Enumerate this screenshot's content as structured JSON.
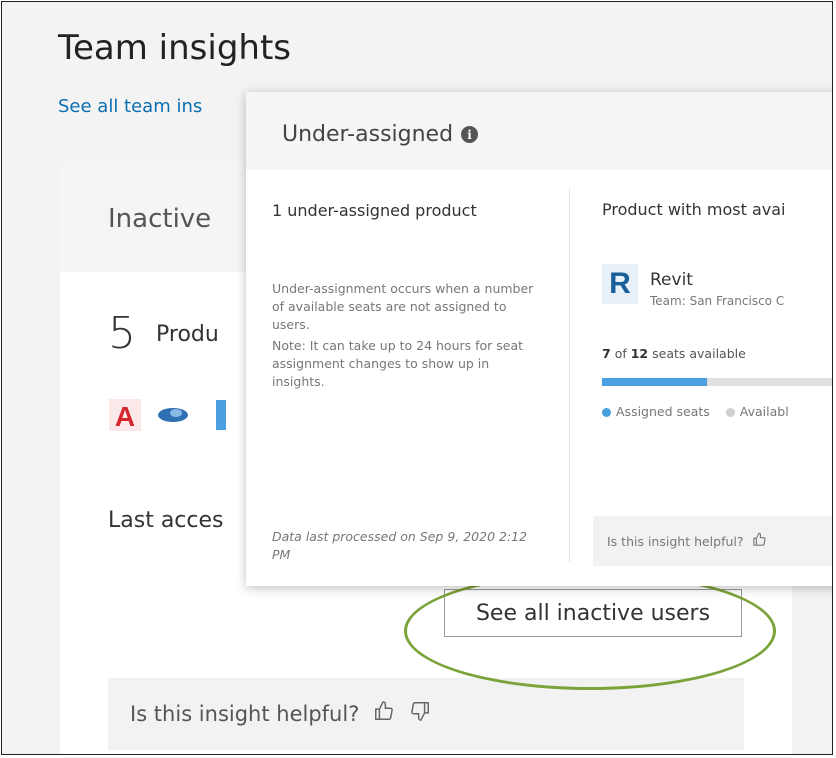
{
  "page": {
    "title": "Team insights",
    "see_all_link": "See all team ins"
  },
  "inactive_card": {
    "title": "Inactive",
    "count": "5",
    "count_label": "Produ",
    "product_icons": [
      "autocad-icon",
      "product-icon-2",
      "product-icon-3"
    ],
    "last_access_label": "Last acces",
    "see_all_button": "See all inactive users",
    "feedback_text": "Is this insight helpful?"
  },
  "popover": {
    "title": "Under-assigned",
    "left": {
      "heading": "1 under-assigned product",
      "description": "Under-assignment occurs when a number of available seats are not assigned to users.",
      "note": "Note: It can take up to 24 hours for seat assignment changes to show up in insights.",
      "processed": "Data last processed on Sep 9, 2020 2:12 PM"
    },
    "right": {
      "heading": "Product with most avai",
      "product_name": "Revit",
      "product_logo_letter": "R",
      "team": "Team: San Francisco C",
      "seats_available": "7",
      "seats_of": "of",
      "seats_total": "12",
      "seats_suffix": "seats available",
      "assigned_fraction": 0.42,
      "legend_assigned": "Assigned seats",
      "legend_available": "Availabl",
      "feedback_text": "Is this insight helpful?"
    }
  },
  "colors": {
    "link": "#0a6fb0",
    "bar_fill": "#4a9fe0",
    "highlight": "#7ca33a",
    "autocad_red": "#d4262c",
    "revit_blue": "#1a5e9a"
  }
}
